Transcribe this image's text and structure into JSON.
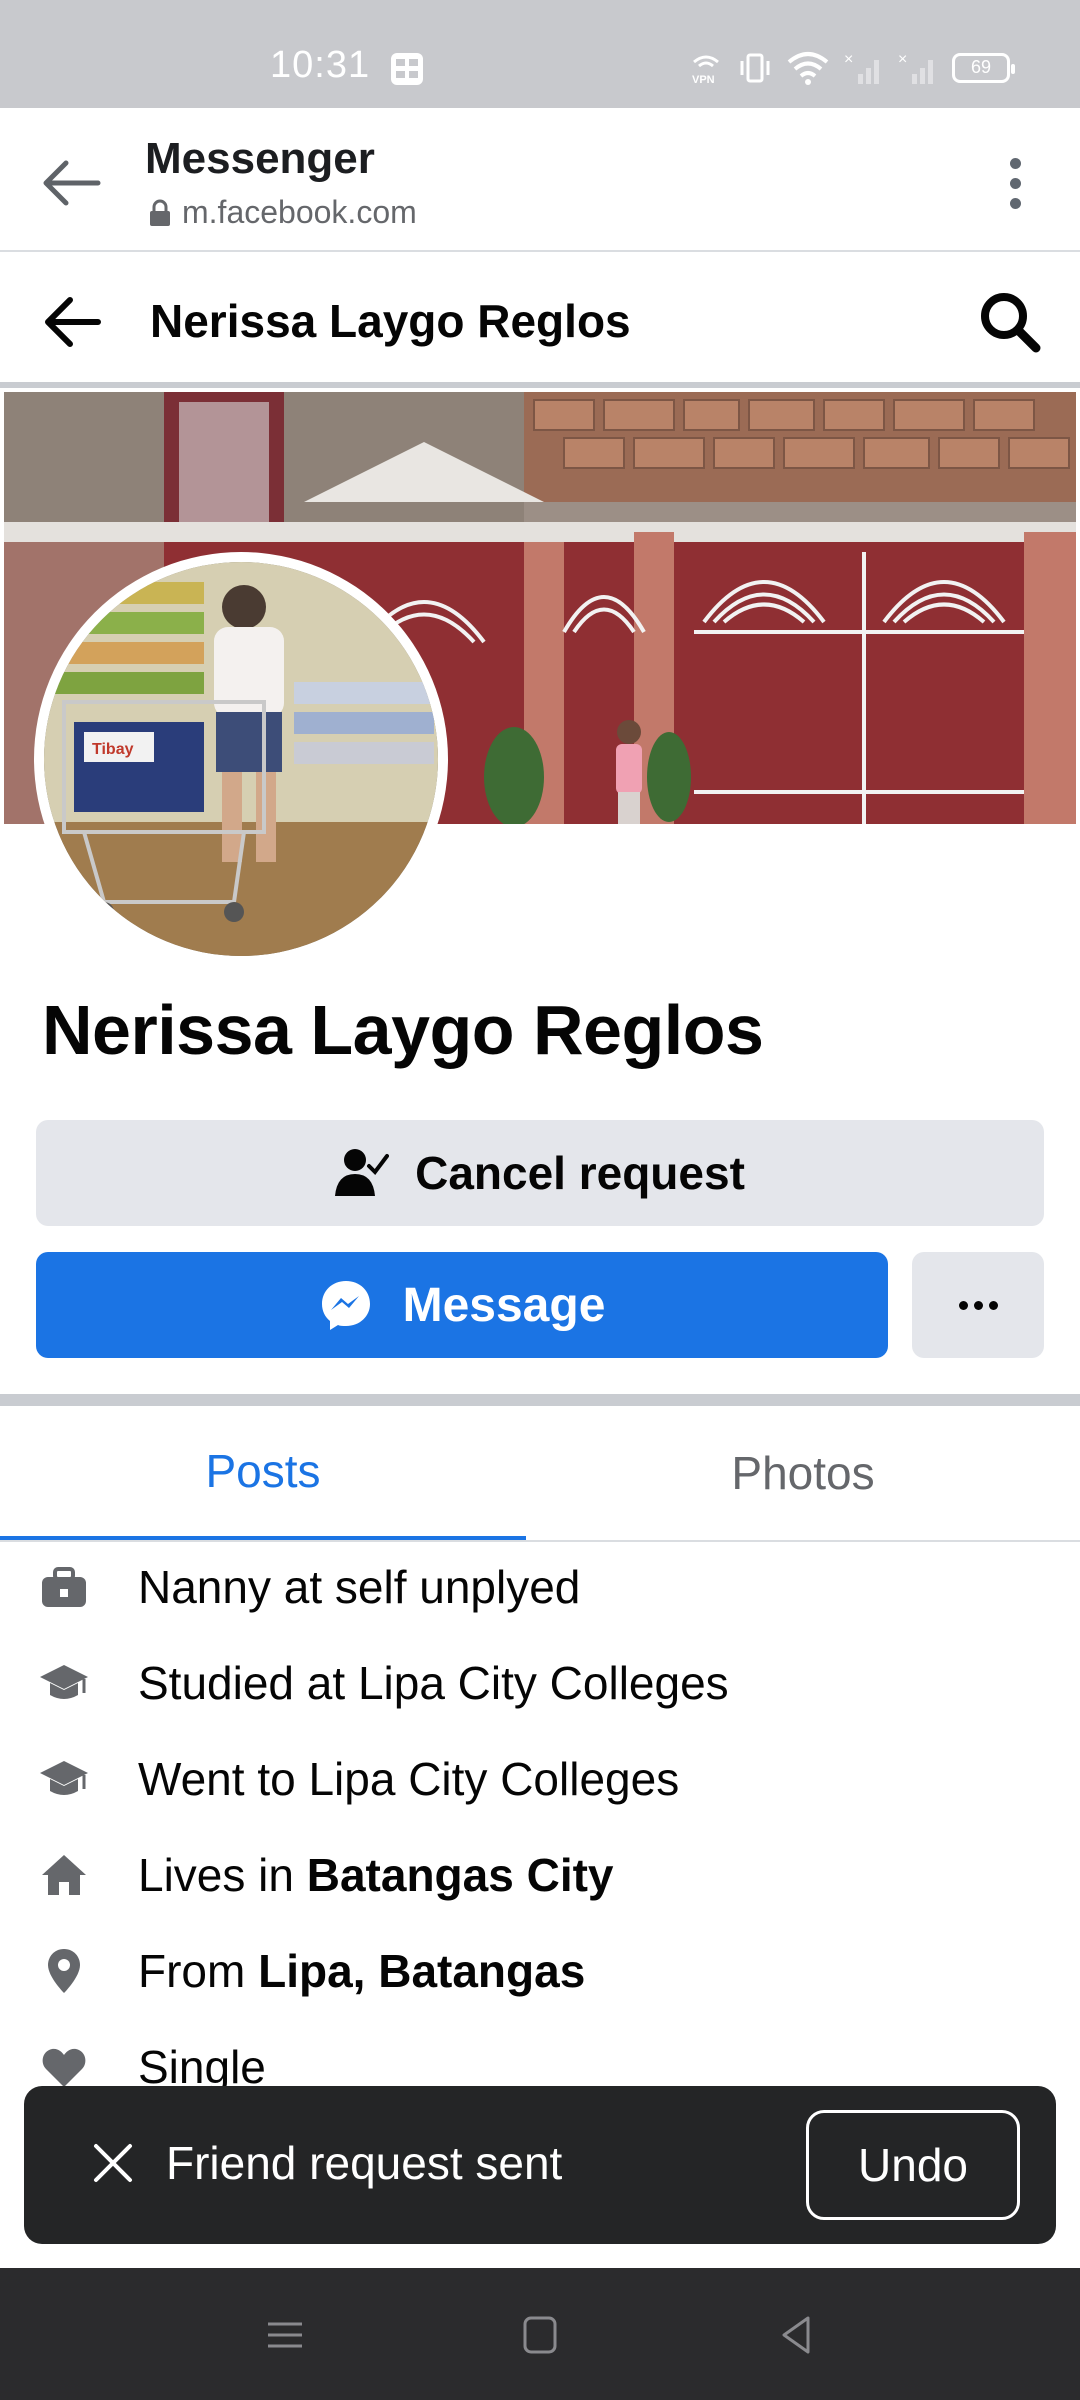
{
  "status_bar": {
    "time": "10:31",
    "battery": "69",
    "icons": [
      "grid-app-icon",
      "vpn-icon",
      "vibrate-icon",
      "wifi-icon",
      "signal-off-icon",
      "signal-off-icon",
      "battery-icon"
    ]
  },
  "browser": {
    "title": "Messenger",
    "url": "m.facebook.com"
  },
  "header": {
    "title": "Nerissa Laygo Reglos"
  },
  "profile": {
    "name": "Nerissa Laygo Reglos",
    "avatar_text": "Tibay"
  },
  "actions": {
    "cancel_request": "Cancel request",
    "message": "Message"
  },
  "tabs": {
    "posts": "Posts",
    "photos": "Photos"
  },
  "intro": [
    {
      "icon": "briefcase-icon",
      "text": "Nanny at self unplyed",
      "bold": ""
    },
    {
      "icon": "graduation-cap-icon",
      "text": "Studied at Lipa City Colleges",
      "bold": ""
    },
    {
      "icon": "graduation-cap-icon",
      "text": "Went to Lipa City Colleges",
      "bold": ""
    },
    {
      "icon": "home-icon",
      "text": "Lives in ",
      "bold": "Batangas City"
    },
    {
      "icon": "location-pin-icon",
      "text": "From ",
      "bold": "Lipa, Batangas"
    },
    {
      "icon": "heart-icon",
      "text": "Single",
      "bold": ""
    }
  ],
  "snackbar": {
    "text": "Friend request sent",
    "action": "Undo"
  },
  "colors": {
    "accent": "#1b74e4",
    "button_gray": "#e4e6eb",
    "snackbar_bg": "#242526",
    "status_bar_bg": "#c8c9cd"
  }
}
